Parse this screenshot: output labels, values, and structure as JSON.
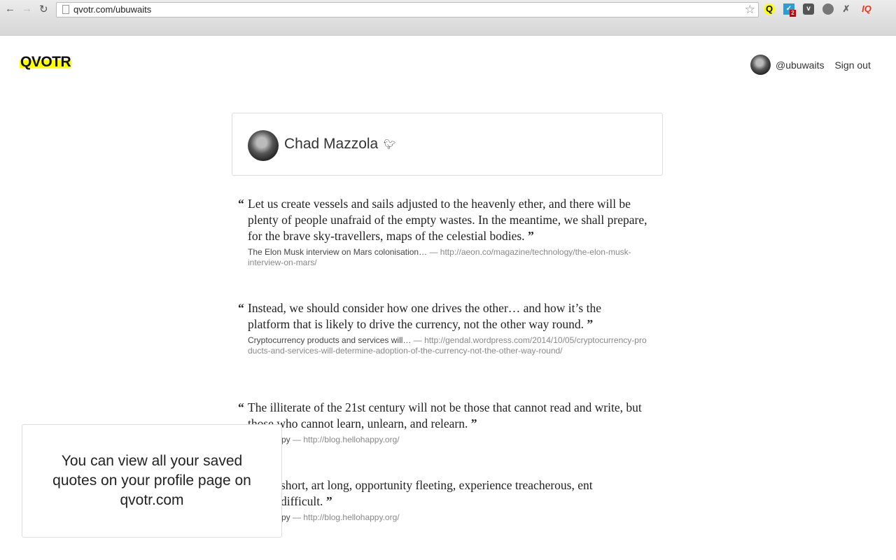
{
  "browser": {
    "url": "qvotr.com/ubuwaits",
    "extension_badge": "2"
  },
  "header": {
    "logo": "QVOTR",
    "username": "@ubuwaits",
    "sign_out": "Sign out"
  },
  "profile": {
    "name": "Chad Mazzola",
    "icon": "twitter-icon"
  },
  "quotes": [
    {
      "text": "Let us create vessels and sails adjusted to the heavenly ether, and there will be plenty of people unafraid of the empty wastes. In the meantime, we shall prepare, for the brave sky-travellers, maps of the celestial bodies.",
      "source": "The Elon Musk interview on Mars colonisation…",
      "url": "http://aeon.co/magazine/technology/the-elon-musk-interview-on-mars/"
    },
    {
      "text": "Instead, we should consider how one drives the other… and how it’s the platform that is likely to drive the currency, not the other way round.",
      "source": "Cryptocurrency products and services will…",
      "url": "http://gendal.wordpress.com/2014/10/05/cryptocurrency-products-and-services-will-determine-adoption-of-the-currency-not-the-other-way-round/"
    },
    {
      "text": "The illiterate of the 21st century will not be those that cannot read and write, but those who cannot learn, unlearn, and relearn.",
      "source": "py",
      "url": "http://blog.hellohappy.org/"
    },
    {
      "text": "short, art long, opportunity fleeting, experience treacherous, ent difficult.",
      "source": "py",
      "url": "http://blog.hellohappy.org/"
    }
  ],
  "popup": {
    "message": "You can view all your saved quotes on your profile page on qvotr.com"
  },
  "colors": {
    "logo_highlight": "#ffff00",
    "ext_iq": "#e8341c"
  }
}
